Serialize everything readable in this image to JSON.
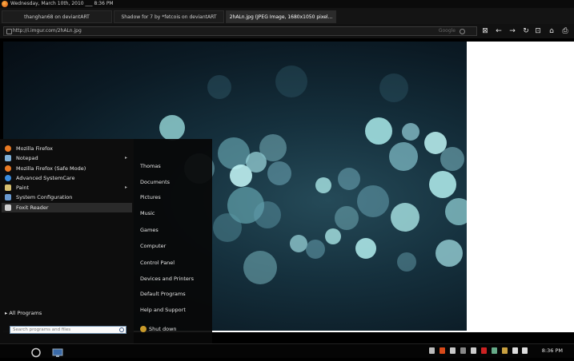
{
  "titlebar": {
    "text": "Wednesday, March 10th, 2010 ___ 8:36 PM"
  },
  "tabs": [
    {
      "label": "thanghan68 on deviantART"
    },
    {
      "label": "Shadow for 7 by *fetcois on deviantART"
    },
    {
      "label": "2hALn.jpg (JPEG Image, 1680x1050 pixel..."
    }
  ],
  "navbar": {
    "url": "http://i.imgur.com/2hALn.jpg",
    "search_engine": "Google",
    "buttons": [
      "stop-icon",
      "back-icon",
      "forward-icon",
      "reload-icon",
      "new-tab-icon",
      "home-icon",
      "print-icon"
    ]
  },
  "startmenu": {
    "programs": [
      {
        "label": "Mozilla Firefox",
        "icon": "firefox-icon",
        "color": "#e87a24",
        "has_arrow": false
      },
      {
        "label": "Notepad",
        "icon": "notepad-icon",
        "color": "#7fb0d8",
        "has_arrow": true
      },
      {
        "label": "Mozilla Firefox (Safe Mode)",
        "icon": "firefox-safe-icon",
        "color": "#e87a24",
        "has_arrow": false
      },
      {
        "label": "Advanced SystemCare",
        "icon": "systemcare-icon",
        "color": "#3a8de0",
        "has_arrow": false
      },
      {
        "label": "Paint",
        "icon": "paint-icon",
        "color": "#d8c070",
        "has_arrow": true
      },
      {
        "label": "System Configuration",
        "icon": "sysconfig-icon",
        "color": "#6a9ad0",
        "has_arrow": false
      },
      {
        "label": "Foxit Reader",
        "icon": "foxit-icon",
        "color": "#d0d0d0",
        "has_arrow": false
      }
    ],
    "arrow": "▸",
    "all_programs": "All Programs",
    "search_placeholder": "Search programs and files",
    "places": [
      "Thomas",
      "Documents",
      "Pictures",
      "Music",
      "Games",
      "Computer",
      "Control Panel",
      "Devices and Printers",
      "Default Programs",
      "Help and Support"
    ],
    "shutdown": "Shut down"
  },
  "taskbar": {
    "clock": "8:36 PM"
  }
}
